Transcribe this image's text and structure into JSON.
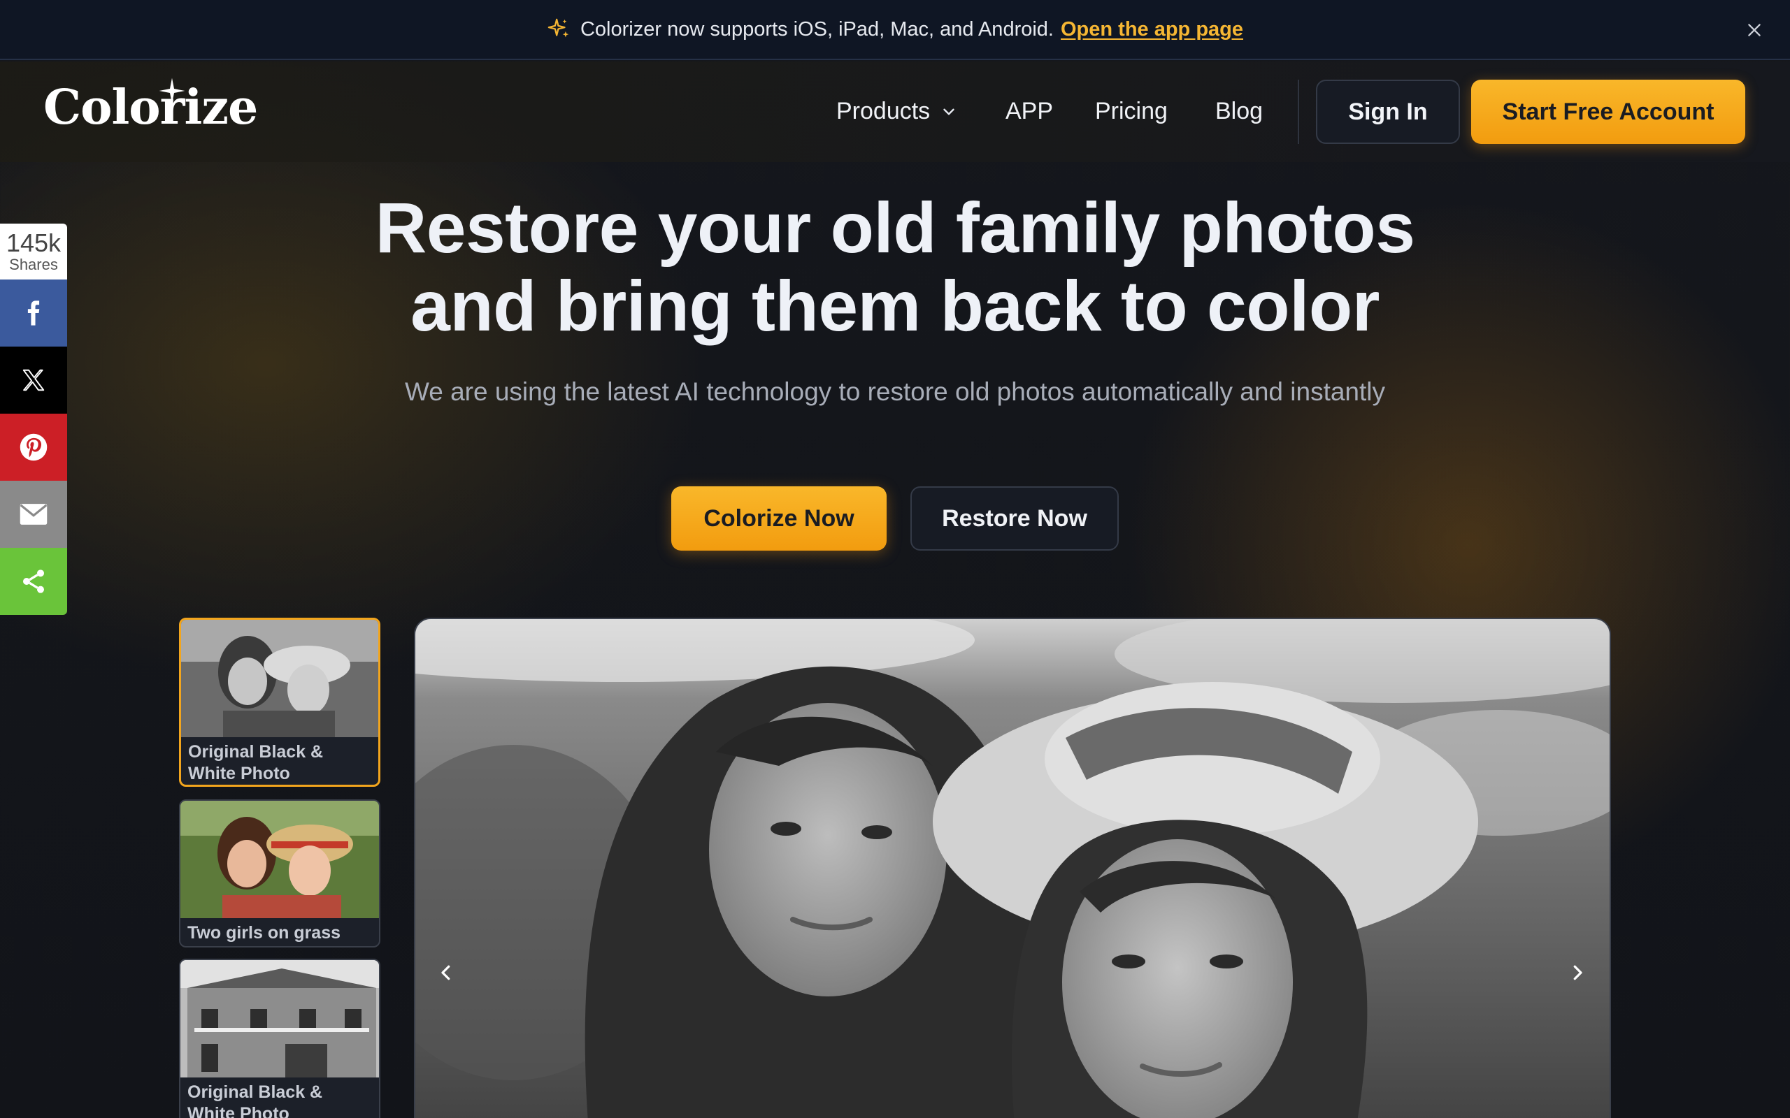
{
  "announcement": {
    "message": "Colorizer now supports iOS, iPad, Mac, and Android.",
    "link_label": "Open the app page"
  },
  "header": {
    "logo": "Colorize",
    "nav": {
      "products": "Products",
      "app": "APP",
      "pricing": "Pricing",
      "blog": "Blog"
    },
    "sign_in": "Sign In",
    "start_free": "Start Free Account"
  },
  "share": {
    "count": "145k",
    "count_label": "Shares",
    "buttons": [
      "facebook",
      "x",
      "pinterest",
      "email",
      "share"
    ]
  },
  "hero": {
    "title_line1": "Restore your old family photos",
    "title_line2": "and bring them back to color",
    "subtitle": "We are using the latest AI technology to restore old photos automatically and instantly",
    "colorize_button": "Colorize Now",
    "restore_button": "Restore Now"
  },
  "gallery": {
    "thumbnails": [
      {
        "caption": "Original Black & White Photo",
        "selected": true
      },
      {
        "caption": "Two girls on grass",
        "selected": false
      },
      {
        "caption": "Original Black & White Photo",
        "selected": false
      }
    ]
  },
  "colors": {
    "accent": "#f5a81c",
    "announce_bg": "#0f1624",
    "facebook": "#3b5a9d",
    "pinterest": "#cc1f26",
    "share_green": "#6ac43a"
  }
}
